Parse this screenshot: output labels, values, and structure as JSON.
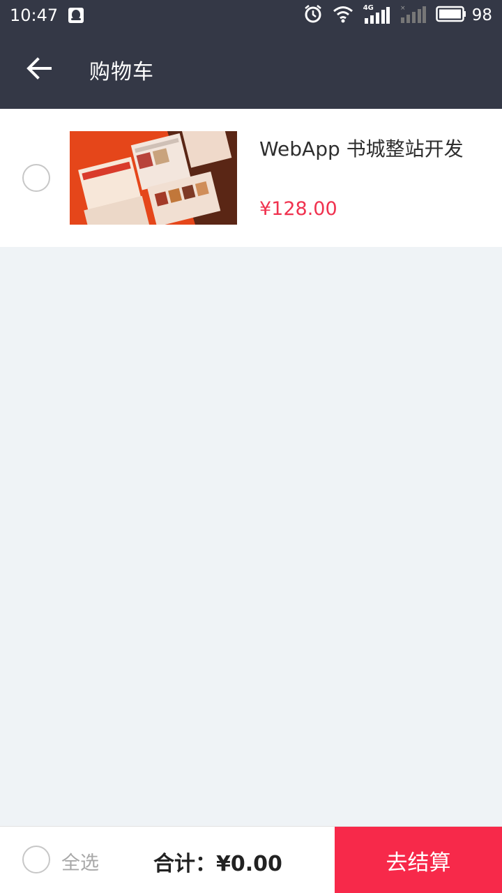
{
  "status_bar": {
    "time": "10:47",
    "network": "4G",
    "battery": "98",
    "icons": [
      "qq-icon",
      "alarm-icon",
      "wifi-icon",
      "signal-icon",
      "signal-2-icon",
      "battery-icon"
    ]
  },
  "nav": {
    "back_icon": "arrow-left-icon",
    "title": "购物车"
  },
  "cart": {
    "items": [
      {
        "title": "WebApp 书城整站开发",
        "price": "¥128.00",
        "selected": false,
        "thumb_color": "#e5461a"
      }
    ]
  },
  "footer": {
    "select_all_label": "全选",
    "total_label": "合计：",
    "total_value": "¥0.00",
    "checkout_label": "去结算"
  },
  "colors": {
    "header_bg": "#343846",
    "price": "#f0324f",
    "checkout_bg": "#f7294a",
    "page_bg": "#eff3f6"
  }
}
